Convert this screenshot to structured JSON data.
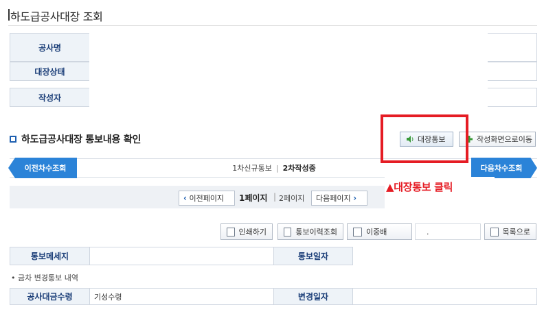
{
  "page": {
    "title": "하도급공사대장 조회"
  },
  "info_form": {
    "rows": [
      {
        "label": "공사명"
      },
      {
        "label": "대장상태"
      },
      {
        "label": "작성자"
      }
    ]
  },
  "section": {
    "title": "하도급공사대장 통보내용 확인"
  },
  "toolbar": {
    "notice_label": "대장통보",
    "write_label": "작성화면으로이동"
  },
  "navigation": {
    "prev_label": "이전차수조회",
    "next_label": "다음차수조회",
    "steps": [
      {
        "label": "1차신규통보",
        "current": false
      },
      {
        "label": "2차작성중",
        "current": true
      }
    ]
  },
  "annotation": {
    "text": "▲대장통보 클릭",
    "color": "#e51c24"
  },
  "pager": {
    "prev_label": "이전페이지",
    "current_label": "1페이지",
    "other_label": "2페이지",
    "next_label": "다음페이지"
  },
  "actions": {
    "print_label": "인쇄하기",
    "history_label": "통보이력조회",
    "double_label": "이중배",
    "dot_label": ".",
    "list_label": "목록으로"
  },
  "notice_table": {
    "message_label": "통보메세지",
    "date_label": "통보일자"
  },
  "change_section": {
    "bullet": "• 금차 변경통보 내역"
  },
  "change_table": {
    "col1_label": "공사대금수령",
    "col1_value": "기성수령",
    "col2_label": "변경일자"
  },
  "colors": {
    "accent": "#2b83d8",
    "header_bg": "#eef3f8",
    "header_text": "#1b3e78",
    "annotation_red": "#e51c24"
  }
}
